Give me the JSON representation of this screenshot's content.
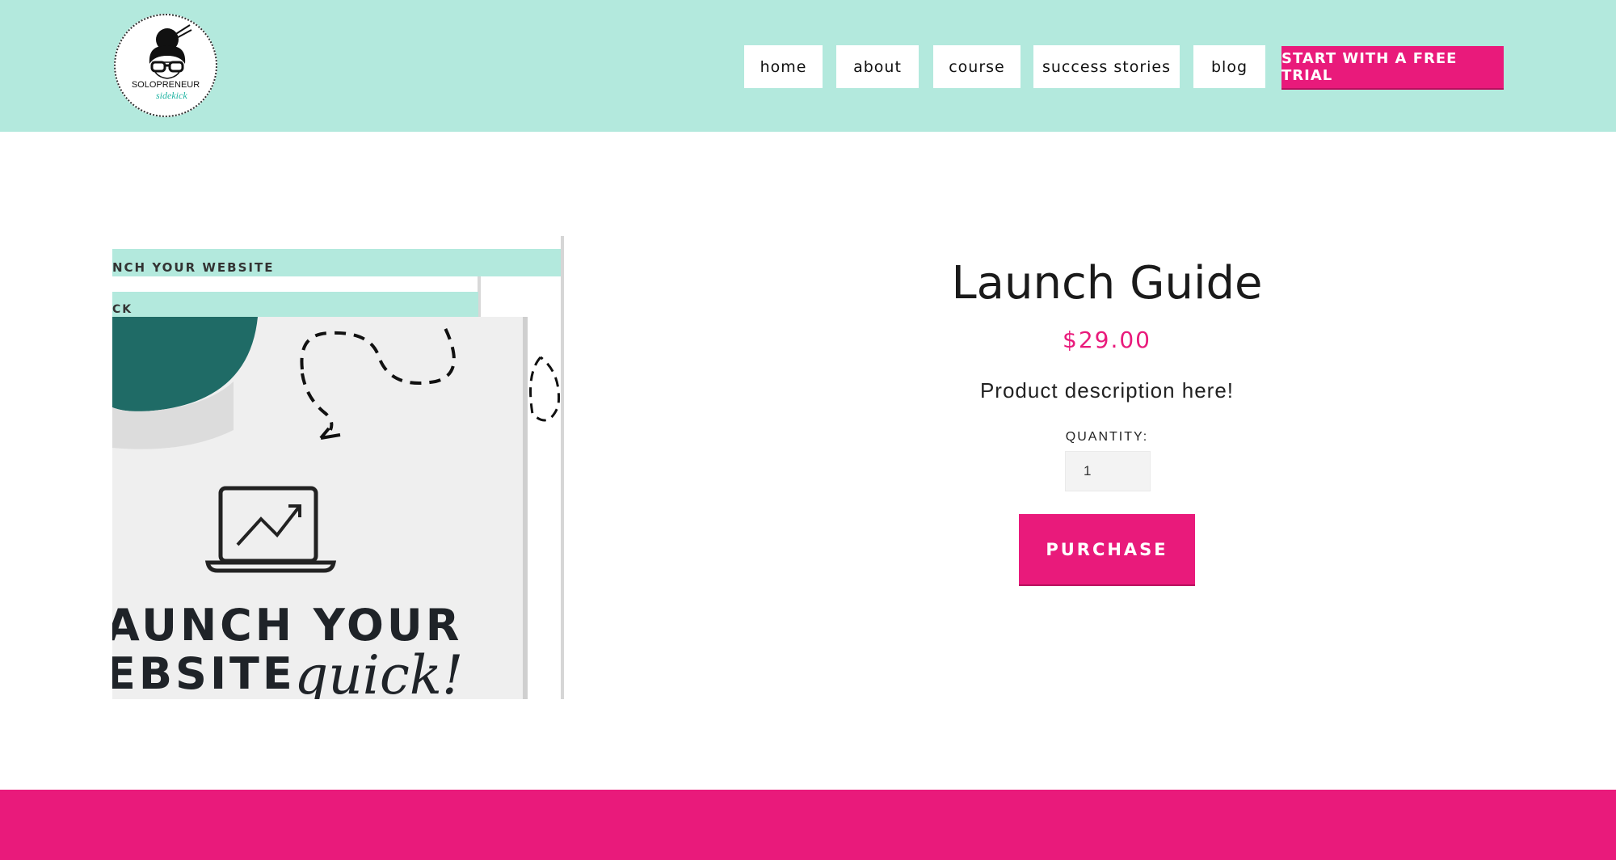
{
  "header": {
    "logo": {
      "line1": "SOLOPRENEUR",
      "line2": "sidekick",
      "icon": "woman-with-glasses-icon"
    },
    "nav": [
      {
        "label": "home"
      },
      {
        "label": "about"
      },
      {
        "label": "course"
      },
      {
        "label": "success stories"
      },
      {
        "label": "blog"
      }
    ],
    "cta_label": "START WITH A FREE TRIAL"
  },
  "product": {
    "image": {
      "banner_text_1": "NCH YOUR WEBSITE",
      "banner_text_2": "CK",
      "headline_line1": "AUNCH YOUR",
      "headline_line2": "EBSITE",
      "headline_script": "quick!"
    },
    "title": "Launch Guide",
    "price": "$29.00",
    "description": "Product description here!",
    "quantity_label": "QUANTITY:",
    "quantity_value": "1",
    "purchase_label": "PURCHASE"
  },
  "colors": {
    "header_bg": "#b3e9dd",
    "accent": "#e91a7b",
    "mint": "#b3e9dd",
    "teal": "#1f6b66"
  }
}
